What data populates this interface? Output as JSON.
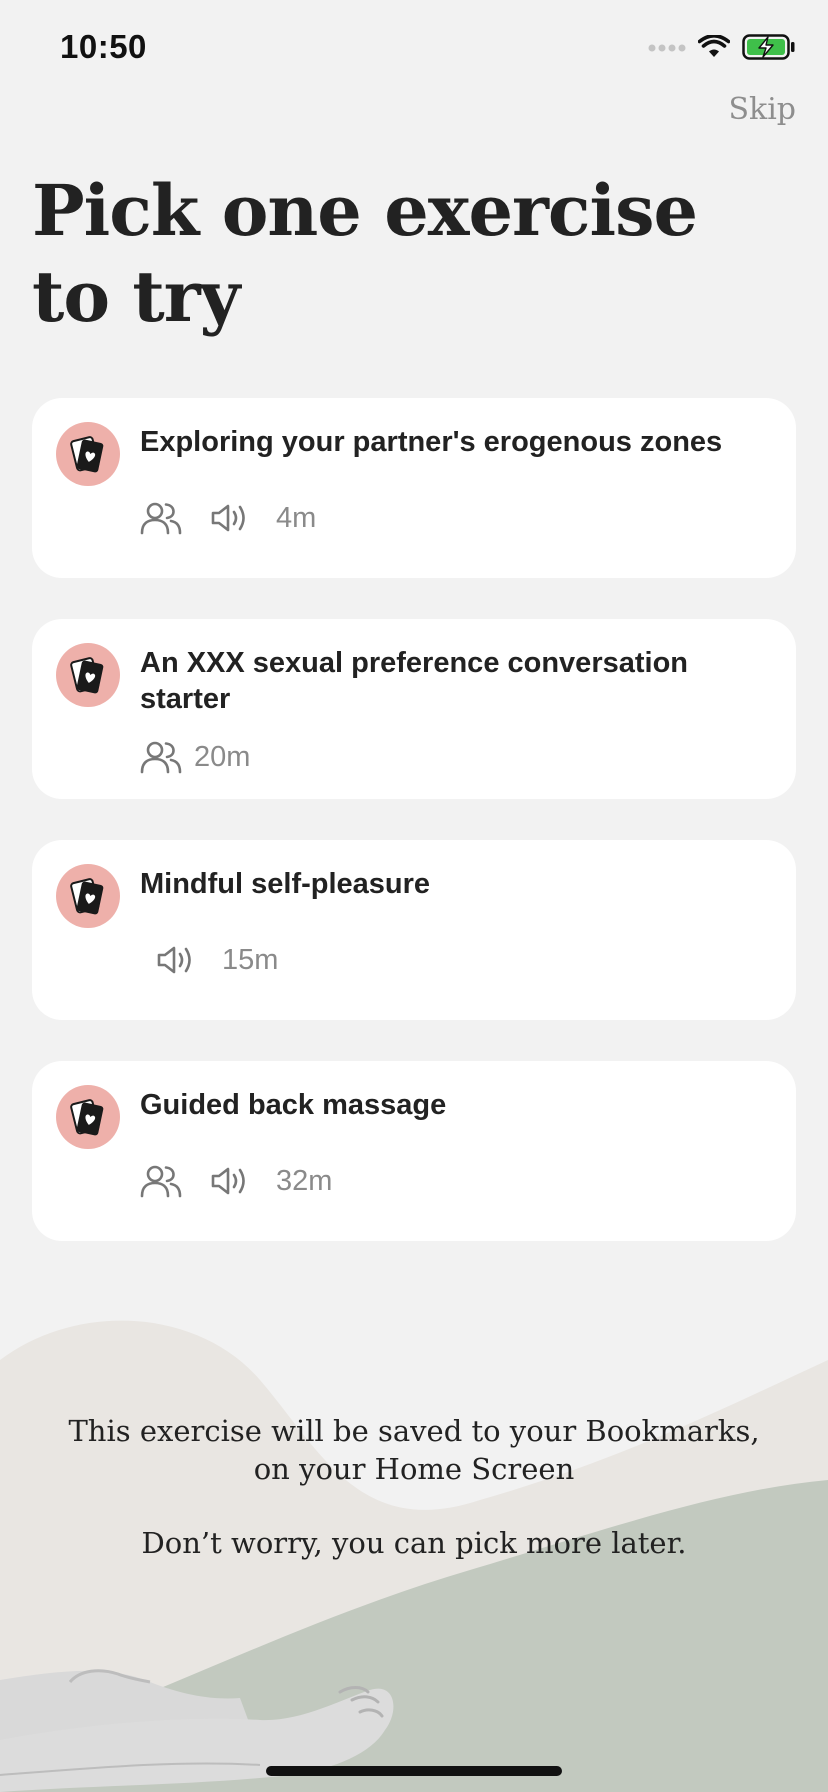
{
  "status_bar": {
    "time": "10:50",
    "colors": {
      "battery": "#3fbf4a"
    }
  },
  "header": {
    "skip_label": "Skip",
    "title": "Pick one exercise to try"
  },
  "exercises": [
    {
      "title": "Exploring your partner's erogenous zones",
      "partner": true,
      "audio": true,
      "duration": "4m"
    },
    {
      "title": "An XXX sexual preference conversation starter",
      "partner": true,
      "audio": false,
      "duration": "20m"
    },
    {
      "title": "Mindful self-pleasure",
      "partner": false,
      "audio": true,
      "duration": "15m"
    },
    {
      "title": "Guided back massage",
      "partner": true,
      "audio": true,
      "duration": "32m"
    }
  ],
  "icons": {
    "exercise": "cards-icon",
    "partner": "people-icon",
    "audio": "speaker-icon"
  },
  "footer": {
    "saved_note": "This exercise will be saved to your Bookmarks, on your Home Screen",
    "reassurance": "Don’t worry, you can pick more later."
  },
  "colors": {
    "background": "#f2f2f2",
    "card": "#ffffff",
    "icon_circle": "#eeb0aa",
    "wave_green": "#c2c9bf",
    "wave_beige": "#e9e6e2"
  }
}
